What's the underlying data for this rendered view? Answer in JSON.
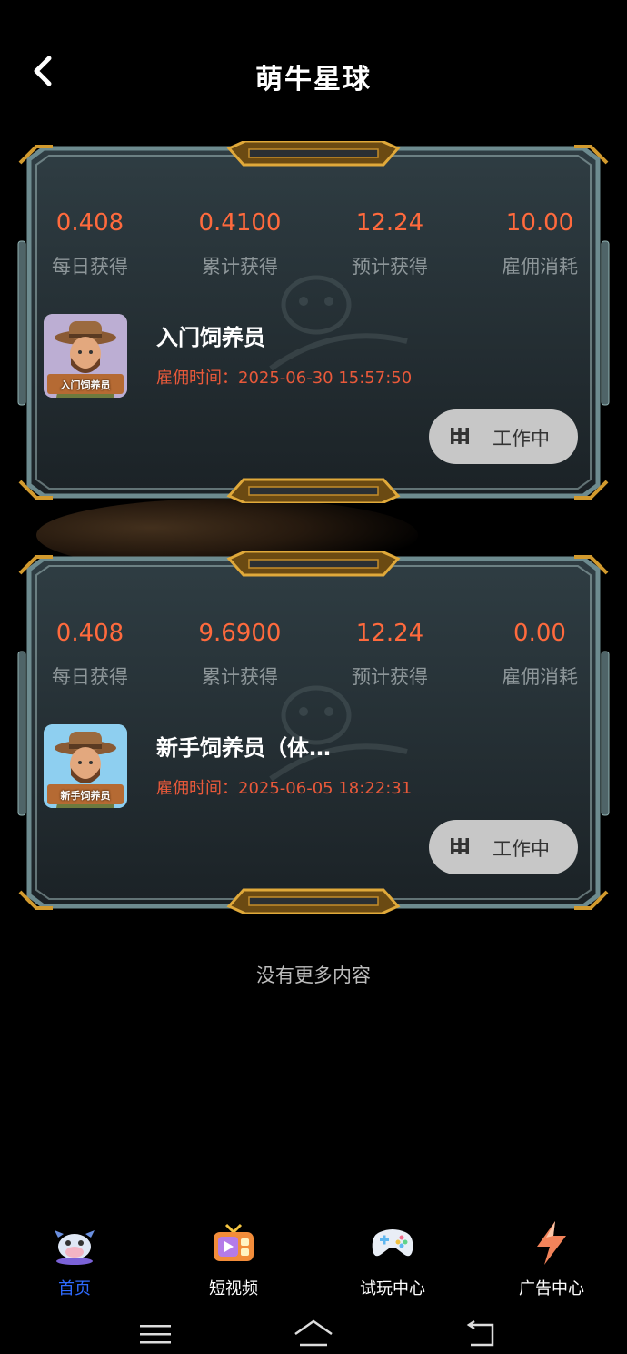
{
  "header": {
    "title": "萌牛星球"
  },
  "cards": [
    {
      "stats": [
        {
          "value": "0.408",
          "label": "每日获得"
        },
        {
          "value": "0.4100",
          "label": "累计获得"
        },
        {
          "value": "12.24",
          "label": "预计获得"
        },
        {
          "value": "10.00",
          "label": "雇佣消耗"
        }
      ],
      "avatar_tag": "入门饲养员",
      "name": "入门饲养员",
      "hire_time": "雇佣时间：2025-06-30 15:57:50",
      "status": "工作中"
    },
    {
      "stats": [
        {
          "value": "0.408",
          "label": "每日获得"
        },
        {
          "value": "9.6900",
          "label": "累计获得"
        },
        {
          "value": "12.24",
          "label": "预计获得"
        },
        {
          "value": "0.00",
          "label": "雇佣消耗"
        }
      ],
      "avatar_tag": "新手饲养员",
      "name": "新手饲养员（体…",
      "hire_time": "雇佣时间：2025-06-05 18:22:31",
      "status": "工作中"
    }
  ],
  "no_more": "没有更多内容",
  "tabs": [
    {
      "label": "首页",
      "icon": "cow-mascot-icon",
      "active": true
    },
    {
      "label": "短视频",
      "icon": "tv-icon",
      "active": false
    },
    {
      "label": "试玩中心",
      "icon": "gamepad-icon",
      "active": false
    },
    {
      "label": "广告中心",
      "icon": "lightning-icon",
      "active": false
    }
  ],
  "colors": {
    "value": "#ff6a3d",
    "hire_time": "#e9593a",
    "active_tab": "#2f6bff"
  }
}
